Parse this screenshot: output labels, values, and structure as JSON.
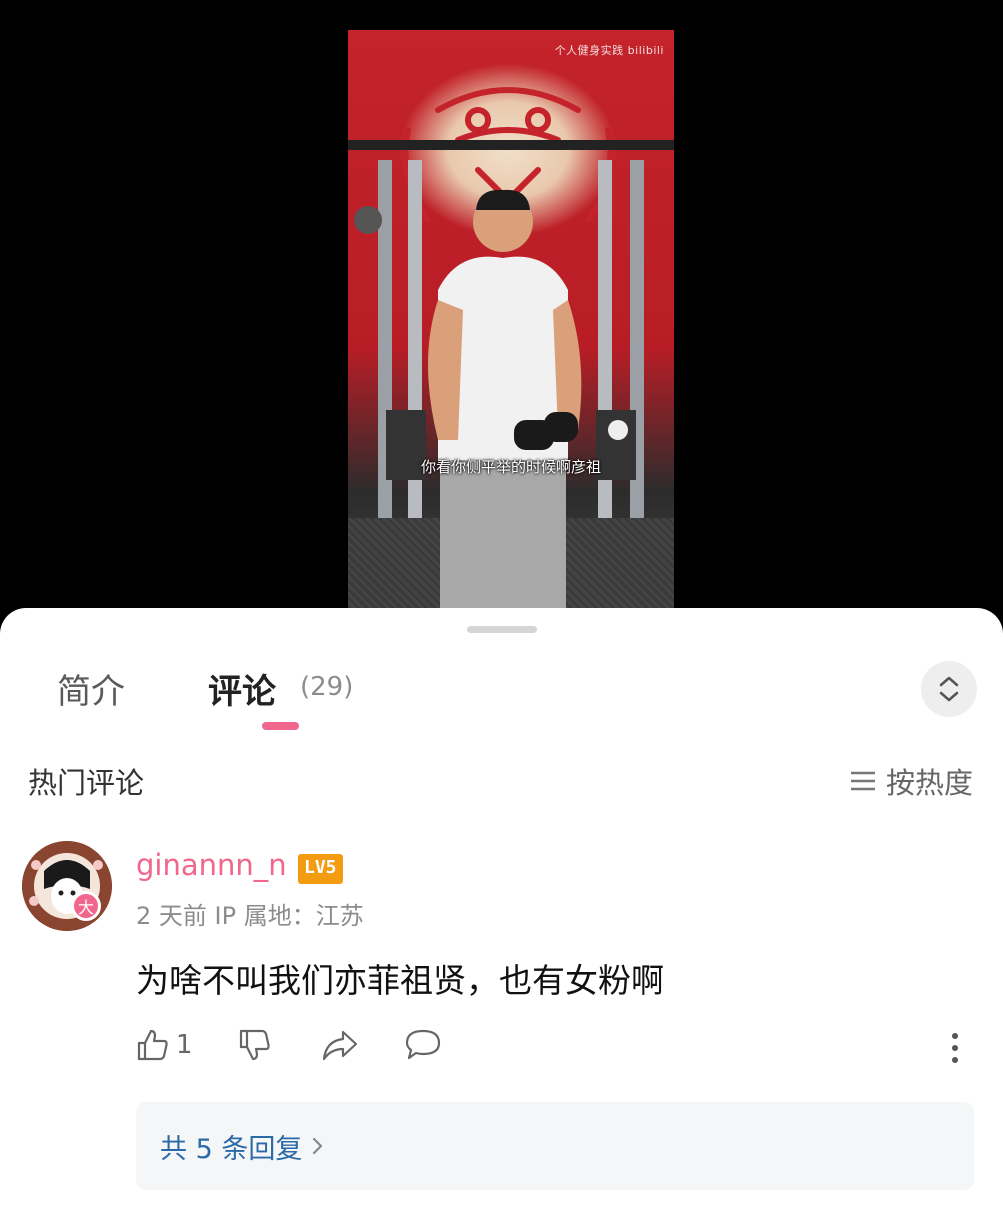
{
  "video": {
    "subtitle": "你看你侧平举的时候啊彦祖",
    "watermark": "个人健身实践  bilibili"
  },
  "tabs": [
    {
      "label": "简介"
    },
    {
      "label": "评论",
      "count": "(29)"
    }
  ],
  "hot_comments": {
    "title": "热门评论",
    "sort_label": "按热度"
  },
  "comment": {
    "username": "ginannn_n",
    "level": "LV5",
    "avatar_badge": "大",
    "meta": "2 天前  IP 属地：江苏",
    "text": "为啥不叫我们亦菲祖贤，也有女粉啊",
    "like_count": "1",
    "replies_label": "共 5 条回复"
  },
  "colors": {
    "accent_pink": "#f0668c",
    "level_orange": "#f39c12",
    "link_blue": "#2b6aa8"
  }
}
